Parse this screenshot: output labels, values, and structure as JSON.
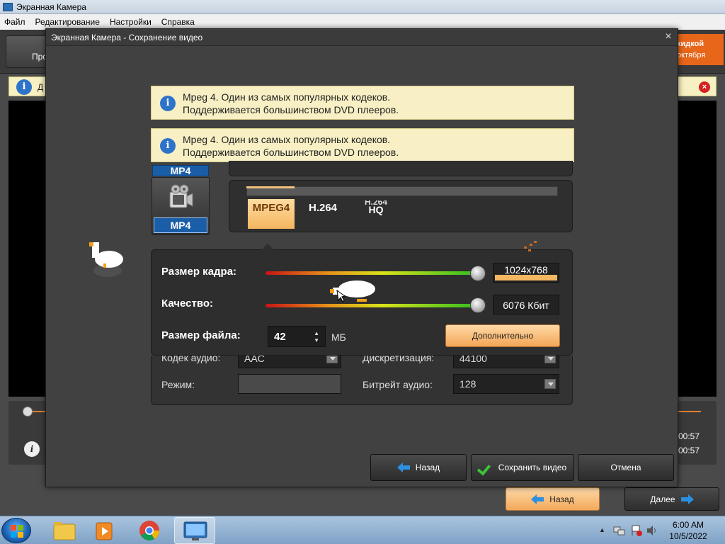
{
  "app": {
    "title": "Экранная Камера",
    "menu": [
      "Файл",
      "Редактирование",
      "Настройки",
      "Справка"
    ],
    "toolbar_button_label": "Про",
    "promo_line1": "кидкой",
    "promo_line2": "октября",
    "infobar_text": "Д",
    "time1": "00:57",
    "time2": "00:57",
    "footer_back": "Назад",
    "footer_next": "Далее"
  },
  "dialog": {
    "title": "Экранная Камера - Сохранение видео",
    "close_glyph": "×",
    "tip1": {
      "line1": "Mpeg 4. Один из самых популярных кодеков.",
      "line2": "Поддерживается большинством DVD плееров."
    },
    "tip2": {
      "line1": "Mpeg 4. Один из самых популярных кодеков.",
      "line2": "Поддерживается большинством DVD плееров."
    },
    "format_label_top": "MP4",
    "format_label": "MP4",
    "codecs": [
      {
        "label": "MPEG4",
        "selected": true
      },
      {
        "label": "H.264",
        "selected": false
      },
      {
        "label": "H.264 HQ",
        "top": "H.264",
        "bottom": "HQ",
        "selected": false
      }
    ],
    "settings": {
      "frame_size_label": "Размер кадра:",
      "frame_size_value": "1024x768",
      "frame_size_level": 1.0,
      "quality_label": "Качество:",
      "quality_value": "6076 Кбит",
      "quality_level": 1.0,
      "file_size_label": "Размер файла:",
      "file_size_value": "42",
      "file_size_unit": "МБ",
      "advanced_button": "Дополнительно"
    },
    "audio": {
      "codec_label": "Кодек аудио:",
      "codec_value": "AAC",
      "sampling_label": "Дискретизация:",
      "sampling_value": "44100",
      "mode_label": "Режим:",
      "mode_value": "",
      "bitrate_label": "Битрейт аудио:",
      "bitrate_value": "128"
    },
    "buttons": {
      "back": "Назад",
      "save": "Сохранить видео",
      "cancel": "Отмена"
    }
  },
  "taskbar": {
    "clock_time": "6:00 AM",
    "clock_date": "10/5/2022"
  },
  "colors": {
    "accent_orange": "#f2a656",
    "info_blue": "#2d74c9",
    "tip_background": "#f8f0c4",
    "format_blue": "#1b5ea8"
  }
}
